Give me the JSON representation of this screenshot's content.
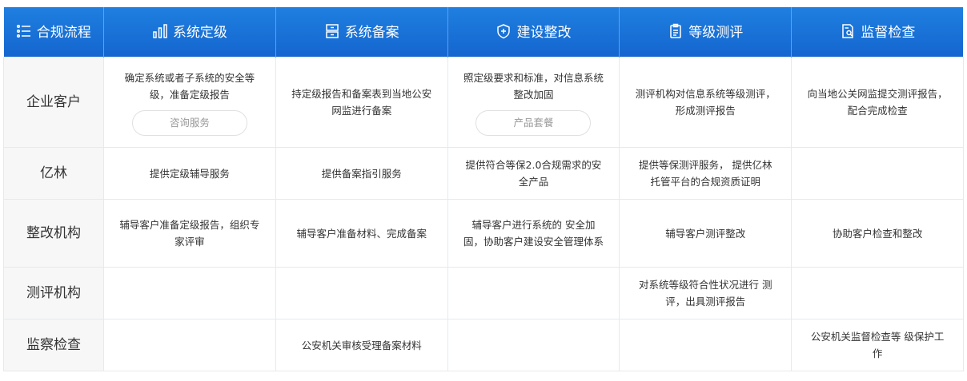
{
  "header": {
    "columns": [
      {
        "label": "合规流程",
        "icon": "list-icon"
      },
      {
        "label": "系统定级",
        "icon": "bar-chart-icon"
      },
      {
        "label": "系统备案",
        "icon": "archive-icon"
      },
      {
        "label": "建设整改",
        "icon": "shield-plus-icon"
      },
      {
        "label": "等级测评",
        "icon": "clipboard-icon"
      },
      {
        "label": "监督检查",
        "icon": "inspect-icon"
      }
    ]
  },
  "rows": [
    {
      "label": "企业客户",
      "cells": [
        {
          "text": "确定系统或者子系统的安全等级，准备定级报告",
          "button": "咨询服务"
        },
        {
          "text": "持定级报告和备案表到当地公安网监进行备案"
        },
        {
          "text": "照定级要求和标准，对信息系统整改加固",
          "button": "产品套餐"
        },
        {
          "text": "测评机构对信息系统等级测评，形成测评报告"
        },
        {
          "text": "向当地公关网监提交测评报告，配合完成检查"
        }
      ]
    },
    {
      "label": "亿林",
      "cells": [
        {
          "text": "提供定级辅导服务"
        },
        {
          "text": "提供备案指引服务"
        },
        {
          "text": "提供符合等保2.0合规需求的安全产品"
        },
        {
          "text": "提供等保测评服务， 提供亿林托管平台的合规资质证明"
        },
        {
          "text": ""
        }
      ]
    },
    {
      "label": "整改机构",
      "cells": [
        {
          "text": "辅导客户准备定级报告，组织专家评审"
        },
        {
          "text": "辅导客户准备材料、完成备案"
        },
        {
          "text": "辅导客户进行系统的 安全加固，协助客户建设安全管理体系"
        },
        {
          "text": "辅导客户测评整改"
        },
        {
          "text": "协助客户检查和整改"
        }
      ]
    },
    {
      "label": "测评机构",
      "cells": [
        {
          "text": ""
        },
        {
          "text": ""
        },
        {
          "text": ""
        },
        {
          "text": "对系统等级符合性状况进行 测评，出具测评报告"
        },
        {
          "text": ""
        }
      ]
    },
    {
      "label": "监察检查",
      "cells": [
        {
          "text": ""
        },
        {
          "text": "公安机关审核受理备案材料"
        },
        {
          "text": ""
        },
        {
          "text": ""
        },
        {
          "text": "公安机关监督检查等 级保护工作"
        }
      ]
    }
  ]
}
